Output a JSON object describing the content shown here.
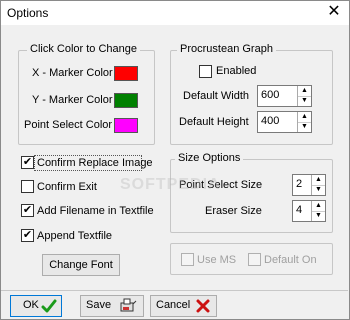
{
  "window": {
    "title": "Options",
    "close_glyph": "✕"
  },
  "colors_group": {
    "title": "Click Color to Change",
    "items": [
      {
        "label": "X - Marker Color",
        "color": "#ff0000"
      },
      {
        "label": "Y - Marker Color",
        "color": "#008000"
      },
      {
        "label": "Point Select Color",
        "color": "#ff00ff"
      }
    ]
  },
  "procrustean_group": {
    "title": "Procrustean Graph",
    "enabled_label": "Enabled",
    "enabled_checked": false,
    "width_label": "Default Width",
    "width_value": "600",
    "height_label": "Default  Height",
    "height_value": "400"
  },
  "options": [
    {
      "label": "Confirm Replace Image",
      "checked": true
    },
    {
      "label": "Confirm Exit",
      "checked": false
    },
    {
      "label": "Add Filename in Textfile",
      "checked": true
    },
    {
      "label": "Append Textfile",
      "checked": true
    }
  ],
  "change_font_label": "Change Font",
  "size_group": {
    "title": "Size Options",
    "point_label": "Point Select Size",
    "point_value": "2",
    "eraser_label": "Eraser Size",
    "eraser_value": "4"
  },
  "disabled_options": [
    {
      "label": "Use MS",
      "checked": false
    },
    {
      "label": "Default On",
      "checked": false
    }
  ],
  "watermark": "SOFTPEDIA",
  "buttons": {
    "ok": "OK",
    "save": "Save",
    "cancel": "Cancel"
  },
  "icons": {
    "ok": "checkmark-icon",
    "save": "save-icon",
    "cancel": "cancel-x-icon",
    "check_glyph": "✔",
    "up_glyph": "▲",
    "down_glyph": "▼"
  }
}
